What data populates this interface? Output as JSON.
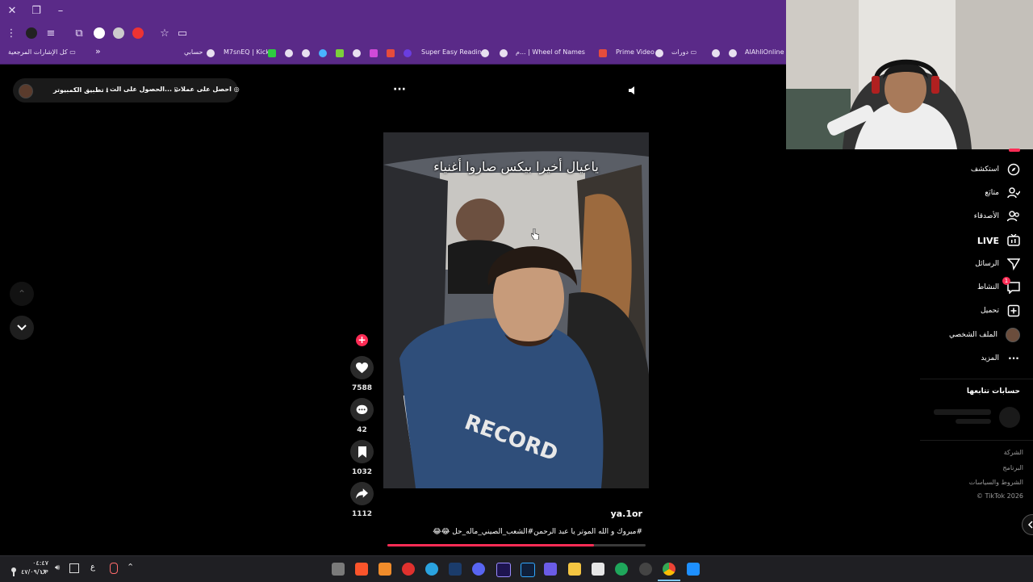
{
  "browser": {
    "bookmarks": [
      {
        "label": "AlAhliOnline"
      },
      {
        "label": "دورات"
      },
      {
        "label": "Prime Video"
      },
      {
        "label": "م... | Wheel of Names"
      },
      {
        "label": "Super Easy Reading"
      },
      {
        "label": "M7snEQ | Kick"
      },
      {
        "label": "حسابي"
      }
    ],
    "all_bookmarks_label": "كل الإشارات المرجعية",
    "overflow_label": "»"
  },
  "topbar": {
    "coins_label": "احصل على عملات",
    "get_app_label": "الحصول على الت...",
    "desktop_app_label": "تطبيق الكمبيوتر",
    "more_label": "···"
  },
  "video": {
    "caption_overlay": "ياعيال أخيرا بيكس صاروا أغنياء",
    "author": "ya.1or",
    "description": "#مبروك و الله الموتر يا عبد الرحمن#الشعب_الصيني_ماله_حل 😂😂"
  },
  "actions": {
    "likes": "7588",
    "comments": "42",
    "saves": "1032",
    "shares": "1112"
  },
  "sidebar": {
    "items": [
      {
        "label": "استكشف",
        "icon": "compass-icon"
      },
      {
        "label": "متابَع",
        "icon": "user-check-icon"
      },
      {
        "label": "الأصدقاء",
        "icon": "friends-icon"
      },
      {
        "label": "LIVE",
        "icon": "live-icon"
      },
      {
        "label": "الرسائل",
        "icon": "send-icon"
      },
      {
        "label": "النشاط",
        "icon": "activity-icon",
        "badge": "1"
      },
      {
        "label": "تحميل",
        "icon": "upload-icon"
      },
      {
        "label": "الملف الشخصي",
        "icon": "avatar-icon"
      },
      {
        "label": "المزيد",
        "icon": "more-icon"
      }
    ],
    "following_heading": "حسابات تتابعها",
    "footer": [
      "الشركة",
      "البرنامج",
      "الشروط والسياسات",
      "© TikTok 2026"
    ]
  },
  "taskbar": {
    "time": "٠٤:٤٧ ص",
    "date": "٤٧/٠٩/١٦",
    "lang": "ع"
  },
  "colors": {
    "browser_purple": "#5a2a88",
    "tiktok_red": "#fe2c55",
    "background": "#000000"
  }
}
